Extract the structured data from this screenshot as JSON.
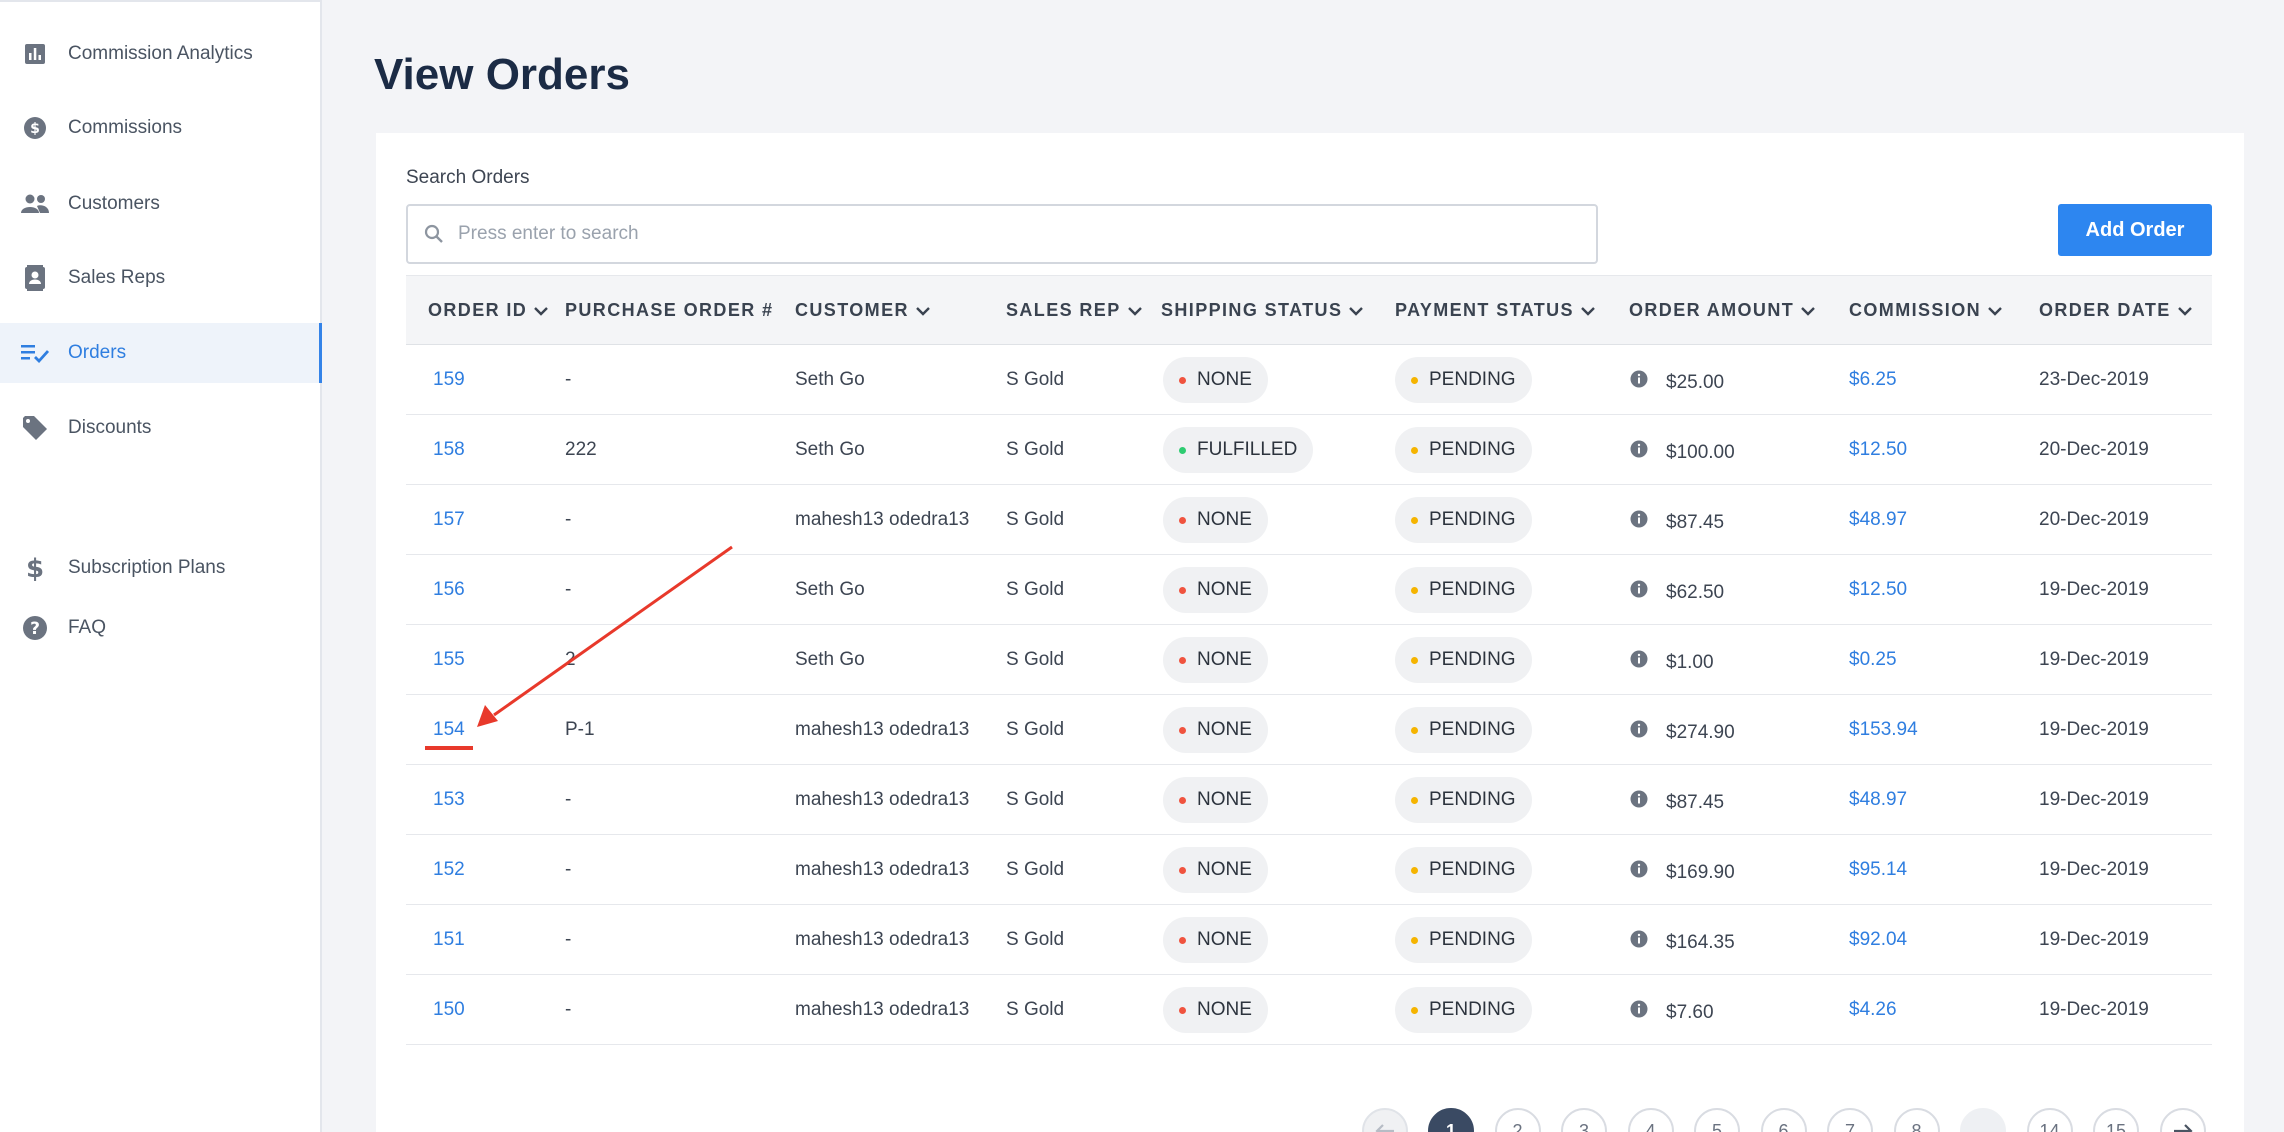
{
  "sidebar": {
    "items": [
      {
        "label": "Commission Analytics",
        "icon": "bar-chart-icon"
      },
      {
        "label": "Commissions",
        "icon": "dollar-circle-icon"
      },
      {
        "label": "Customers",
        "icon": "people-icon"
      },
      {
        "label": "Sales Reps",
        "icon": "contact-card-icon"
      },
      {
        "label": "Orders",
        "icon": "checklist-icon",
        "active": true
      },
      {
        "label": "Discounts",
        "icon": "tag-icon"
      },
      {
        "label": "Subscription Plans",
        "icon": "dollar-sign-icon"
      },
      {
        "label": "FAQ",
        "icon": "help-circle-icon"
      }
    ]
  },
  "page": {
    "title": "View Orders"
  },
  "search": {
    "label": "Search Orders",
    "placeholder": "Press enter to search",
    "value": ""
  },
  "toolbar": {
    "add_order_label": "Add Order"
  },
  "table": {
    "columns": [
      "ORDER ID",
      "PURCHASE ORDER #",
      "CUSTOMER",
      "SALES REP",
      "SHIPPING STATUS",
      "PAYMENT STATUS",
      "ORDER AMOUNT",
      "COMMISSION",
      "ORDER DATE"
    ],
    "rows": [
      {
        "order_id": "159",
        "po": "-",
        "customer": "Seth Go",
        "sales_rep": "S Gold",
        "shipping": "NONE",
        "payment": "PENDING",
        "amount": "$25.00",
        "commission": "$6.25",
        "date": "23-Dec-2019"
      },
      {
        "order_id": "158",
        "po": "222",
        "customer": "Seth Go",
        "sales_rep": "S Gold",
        "shipping": "FULFILLED",
        "payment": "PENDING",
        "amount": "$100.00",
        "commission": "$12.50",
        "date": "20-Dec-2019"
      },
      {
        "order_id": "157",
        "po": "-",
        "customer": "mahesh13 odedra13",
        "sales_rep": "S Gold",
        "shipping": "NONE",
        "payment": "PENDING",
        "amount": "$87.45",
        "commission": "$48.97",
        "date": "20-Dec-2019"
      },
      {
        "order_id": "156",
        "po": "-",
        "customer": "Seth Go",
        "sales_rep": "S Gold",
        "shipping": "NONE",
        "payment": "PENDING",
        "amount": "$62.50",
        "commission": "$12.50",
        "date": "19-Dec-2019"
      },
      {
        "order_id": "155",
        "po": "2",
        "customer": "Seth Go",
        "sales_rep": "S Gold",
        "shipping": "NONE",
        "payment": "PENDING",
        "amount": "$1.00",
        "commission": "$0.25",
        "date": "19-Dec-2019"
      },
      {
        "order_id": "154",
        "po": "P-1",
        "customer": "mahesh13 odedra13",
        "sales_rep": "S Gold",
        "shipping": "NONE",
        "payment": "PENDING",
        "amount": "$274.90",
        "commission": "$153.94",
        "date": "19-Dec-2019"
      },
      {
        "order_id": "153",
        "po": "-",
        "customer": "mahesh13 odedra13",
        "sales_rep": "S Gold",
        "shipping": "NONE",
        "payment": "PENDING",
        "amount": "$87.45",
        "commission": "$48.97",
        "date": "19-Dec-2019"
      },
      {
        "order_id": "152",
        "po": "-",
        "customer": "mahesh13 odedra13",
        "sales_rep": "S Gold",
        "shipping": "NONE",
        "payment": "PENDING",
        "amount": "$169.90",
        "commission": "$95.14",
        "date": "19-Dec-2019"
      },
      {
        "order_id": "151",
        "po": "-",
        "customer": "mahesh13 odedra13",
        "sales_rep": "S Gold",
        "shipping": "NONE",
        "payment": "PENDING",
        "amount": "$164.35",
        "commission": "$92.04",
        "date": "19-Dec-2019"
      },
      {
        "order_id": "150",
        "po": "-",
        "customer": "mahesh13 odedra13",
        "sales_rep": "S Gold",
        "shipping": "NONE",
        "payment": "PENDING",
        "amount": "$7.60",
        "commission": "$4.26",
        "date": "19-Dec-2019"
      }
    ]
  },
  "pagination": {
    "pages": [
      "1",
      "2",
      "3",
      "4",
      "5",
      "6",
      "7",
      "8",
      "...",
      "14",
      "15"
    ],
    "current": "1"
  },
  "colors": {
    "accent": "#2f7ee0",
    "button": "#2d86f0",
    "status_none_dot": "#f0533e",
    "status_fulfilled_dot": "#2ecc71",
    "status_pending_dot": "#f5b400",
    "annotation_arrow": "#e8392b"
  }
}
